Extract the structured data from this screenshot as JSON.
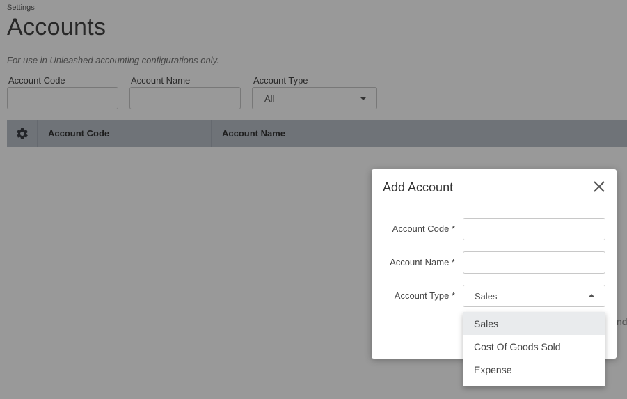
{
  "page": {
    "breadcrumb": "Settings",
    "title": "Accounts",
    "note": "For use in Unleashed accounting configurations only."
  },
  "filters": {
    "account_code_label": "Account Code",
    "account_name_label": "Account Name",
    "account_type_label": "Account Type",
    "account_type_value": "All"
  },
  "grid": {
    "settings_icon": "gear-icon",
    "columns": [
      "Account Code",
      "Account Name"
    ]
  },
  "background_peek_text": "nd",
  "modal": {
    "title": "Add Account",
    "close_icon": "close-icon",
    "fields": {
      "account_code_label": "Account Code *",
      "account_name_label": "Account Name *",
      "account_type_label": "Account Type *",
      "account_type_value": "Sales"
    },
    "dropdown_options": [
      "Sales",
      "Cost Of Goods Sold",
      "Expense"
    ],
    "selected_option": "Sales"
  }
}
